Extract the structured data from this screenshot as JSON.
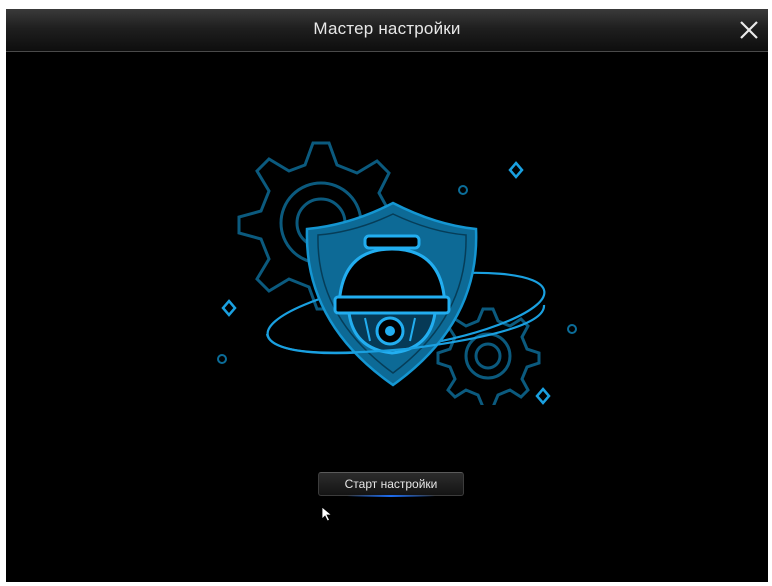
{
  "window": {
    "title": "Мастер настройки",
    "close_icon": "close-icon"
  },
  "main": {
    "illustration_icon": "security-camera-shield-icon",
    "start_button_label": "Старт настройки"
  },
  "colors": {
    "background": "#000000",
    "accent_blue": "#1aa0e0",
    "shield_fill": "#0d6a96",
    "titlebar": "#262626",
    "text": "#e8e8e8"
  }
}
